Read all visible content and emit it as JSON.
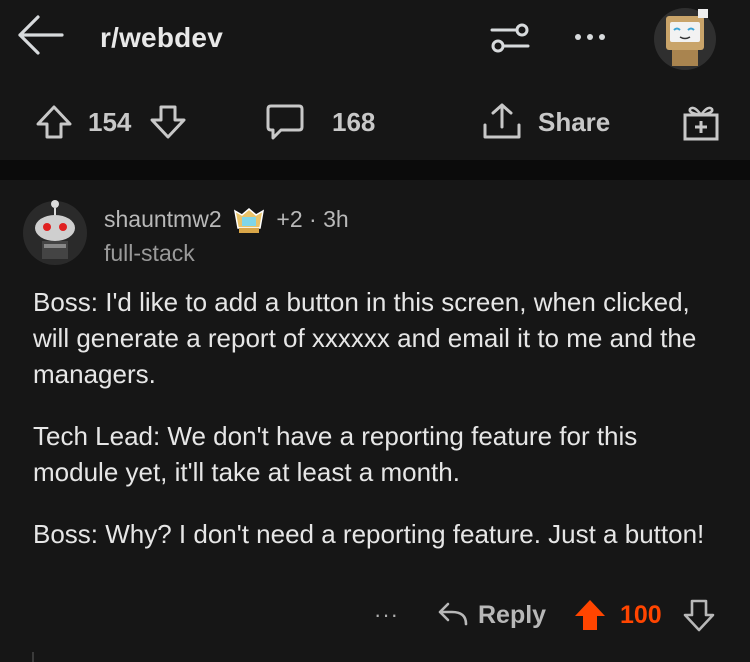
{
  "header": {
    "subreddit": "r/webdev",
    "back_icon": "arrow-left-icon",
    "filter_icon": "sliders-icon",
    "more_icon": "more-horizontal-icon",
    "avatar": "user-avatar"
  },
  "post_actions": {
    "upvote_count": "154",
    "comment_count": "168",
    "share_label": "Share",
    "icons": [
      "upvote-icon",
      "downvote-icon",
      "comment-icon",
      "share-icon",
      "award-icon"
    ]
  },
  "comment": {
    "username": "shauntmw2",
    "award_extra": "+2",
    "time_sep": "·",
    "age": "3h",
    "flair": "full-stack",
    "paragraphs": [
      "Boss: I'd like to add a button in this screen, when clicked, will generate a report of xxxxxx and email it to me and the managers.",
      "Tech Lead: We don't have a reporting feature for this module yet, it'll take at least a month.",
      "Boss: Why? I don't need a reporting feature. Just a button!"
    ],
    "more_label": "···",
    "reply_label": "Reply",
    "score": "100"
  },
  "colors": {
    "background": "#161616",
    "upvote_active": "#ff4500",
    "text": "#e6e6e6"
  }
}
